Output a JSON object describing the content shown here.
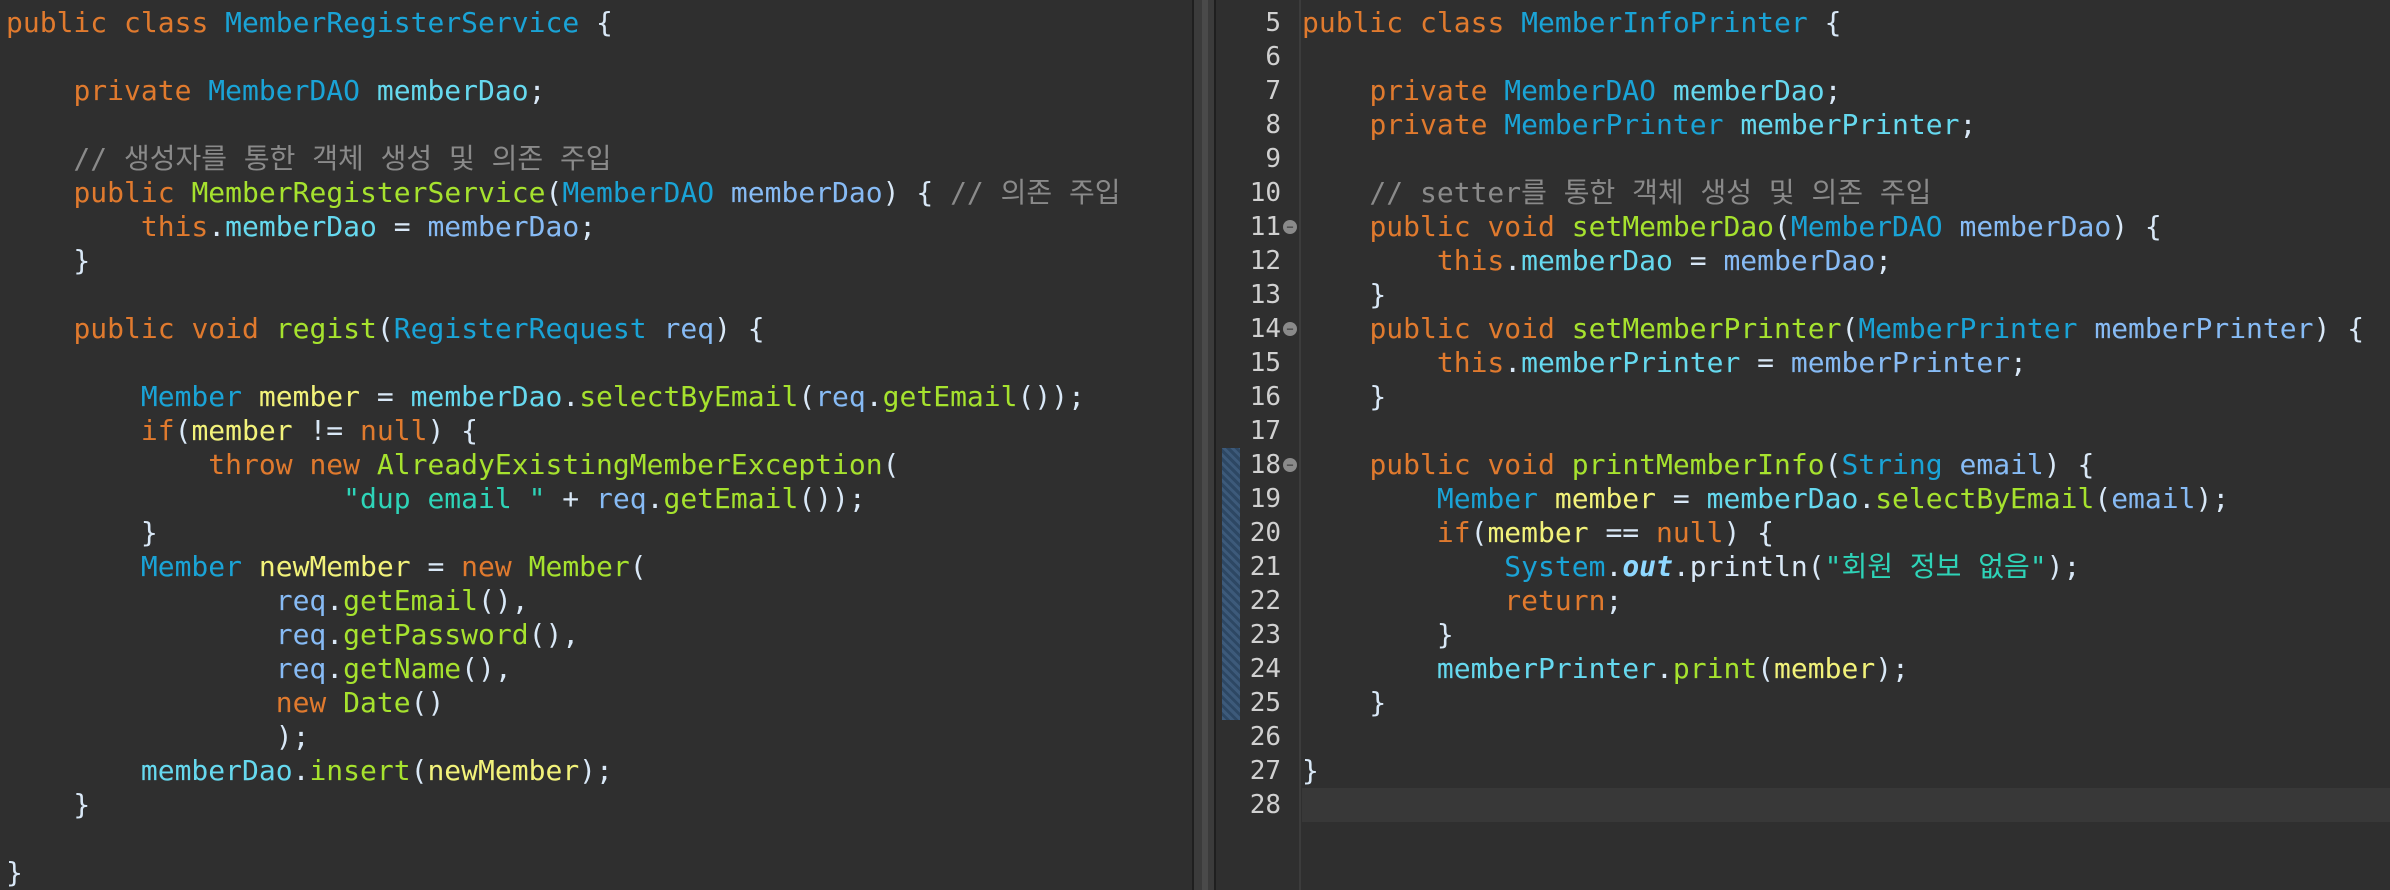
{
  "editor_left": {
    "file": "MemberRegisterService",
    "lines": [
      [
        [
          "kw",
          "public "
        ],
        [
          "kw",
          "class "
        ],
        [
          "ty",
          "MemberRegisterService"
        ],
        [
          "pn",
          " {"
        ]
      ],
      [],
      [
        [
          "pn",
          "    "
        ],
        [
          "kw",
          "private "
        ],
        [
          "ty",
          "MemberDAO "
        ],
        [
          "fld",
          "memberDao"
        ],
        [
          "pn",
          ";"
        ]
      ],
      [],
      [
        [
          "cm",
          "    // 생성자를 통한 객체 생성 및 의존 주입"
        ]
      ],
      [
        [
          "pn",
          "    "
        ],
        [
          "kw",
          "public "
        ],
        [
          "fn",
          "MemberRegisterService"
        ],
        [
          "pn",
          "("
        ],
        [
          "ty",
          "MemberDAO "
        ],
        [
          "pm",
          "memberDao"
        ],
        [
          "pn",
          ") { "
        ],
        [
          "cm",
          "// 의존 주입"
        ]
      ],
      [
        [
          "pn",
          "        "
        ],
        [
          "kw",
          "this"
        ],
        [
          "pn",
          "."
        ],
        [
          "fld",
          "memberDao"
        ],
        [
          "pn",
          " = "
        ],
        [
          "pm",
          "memberDao"
        ],
        [
          "pn",
          ";"
        ]
      ],
      [
        [
          "pn",
          "    }"
        ]
      ],
      [],
      [
        [
          "pn",
          "    "
        ],
        [
          "kw",
          "public "
        ],
        [
          "kw",
          "void "
        ],
        [
          "fn",
          "regist"
        ],
        [
          "pn",
          "("
        ],
        [
          "ty",
          "RegisterRequest "
        ],
        [
          "pm",
          "req"
        ],
        [
          "pn",
          ") {"
        ]
      ],
      [],
      [
        [
          "pn",
          "        "
        ],
        [
          "ty",
          "Member "
        ],
        [
          "lv",
          "member"
        ],
        [
          "pn",
          " = "
        ],
        [
          "fld",
          "memberDao"
        ],
        [
          "pn",
          "."
        ],
        [
          "fn",
          "selectByEmail"
        ],
        [
          "pn",
          "("
        ],
        [
          "pm",
          "req"
        ],
        [
          "pn",
          "."
        ],
        [
          "fn",
          "getEmail"
        ],
        [
          "pn",
          "());"
        ]
      ],
      [
        [
          "pn",
          "        "
        ],
        [
          "kw",
          "if"
        ],
        [
          "pn",
          "("
        ],
        [
          "lv",
          "member"
        ],
        [
          "pn",
          " != "
        ],
        [
          "nl",
          "null"
        ],
        [
          "pn",
          ") {"
        ]
      ],
      [
        [
          "pn",
          "            "
        ],
        [
          "kw",
          "throw "
        ],
        [
          "kw",
          "new "
        ],
        [
          "fn",
          "AlreadyExistingMemberException"
        ],
        [
          "pn",
          "("
        ]
      ],
      [
        [
          "pn",
          "                    "
        ],
        [
          "st",
          "\"dup email \""
        ],
        [
          "pn",
          " + "
        ],
        [
          "pm",
          "req"
        ],
        [
          "pn",
          "."
        ],
        [
          "fn",
          "getEmail"
        ],
        [
          "pn",
          "());"
        ]
      ],
      [
        [
          "pn",
          "        }"
        ]
      ],
      [
        [
          "pn",
          "        "
        ],
        [
          "ty",
          "Member "
        ],
        [
          "lv",
          "newMember"
        ],
        [
          "pn",
          " = "
        ],
        [
          "kw",
          "new "
        ],
        [
          "fn",
          "Member"
        ],
        [
          "pn",
          "("
        ]
      ],
      [
        [
          "pn",
          "                "
        ],
        [
          "pm",
          "req"
        ],
        [
          "pn",
          "."
        ],
        [
          "fn",
          "getEmail"
        ],
        [
          "pn",
          "(),"
        ]
      ],
      [
        [
          "pn",
          "                "
        ],
        [
          "pm",
          "req"
        ],
        [
          "pn",
          "."
        ],
        [
          "fn",
          "getPassword"
        ],
        [
          "pn",
          "(),"
        ]
      ],
      [
        [
          "pn",
          "                "
        ],
        [
          "pm",
          "req"
        ],
        [
          "pn",
          "."
        ],
        [
          "fn",
          "getName"
        ],
        [
          "pn",
          "(),"
        ]
      ],
      [
        [
          "pn",
          "                "
        ],
        [
          "kw",
          "new "
        ],
        [
          "fn",
          "Date"
        ],
        [
          "pn",
          "()"
        ]
      ],
      [
        [
          "pn",
          "                );"
        ]
      ],
      [
        [
          "pn",
          "        "
        ],
        [
          "fld",
          "memberDao"
        ],
        [
          "pn",
          "."
        ],
        [
          "fn",
          "insert"
        ],
        [
          "pn",
          "("
        ],
        [
          "lv",
          "newMember"
        ],
        [
          "pn",
          ");"
        ]
      ],
      [
        [
          "pn",
          "    }"
        ]
      ],
      [],
      [
        [
          "pn",
          "}"
        ]
      ]
    ]
  },
  "editor_right": {
    "file": "MemberInfoPrinter",
    "line_numbers": [
      "5",
      "6",
      "7",
      "8",
      "9",
      "10",
      "11",
      "12",
      "13",
      "14",
      "15",
      "16",
      "17",
      "18",
      "19",
      "20",
      "21",
      "22",
      "23",
      "24",
      "25",
      "26",
      "27",
      "28"
    ],
    "fold_markers": [
      "11",
      "14",
      "18"
    ],
    "lines": [
      [
        [
          "kw",
          "public "
        ],
        [
          "kw",
          "class "
        ],
        [
          "ty",
          "MemberInfoPrinter"
        ],
        [
          "pn",
          " {"
        ]
      ],
      [],
      [
        [
          "pn",
          "    "
        ],
        [
          "kw",
          "private "
        ],
        [
          "ty",
          "MemberDAO "
        ],
        [
          "fld",
          "memberDao"
        ],
        [
          "pn",
          ";"
        ]
      ],
      [
        [
          "pn",
          "    "
        ],
        [
          "kw",
          "private "
        ],
        [
          "ty",
          "MemberPrinter "
        ],
        [
          "fld",
          "memberPrinter"
        ],
        [
          "pn",
          ";"
        ]
      ],
      [],
      [
        [
          "cm",
          "    // setter를 통한 객체 생성 및 의존 주입"
        ]
      ],
      [
        [
          "pn",
          "    "
        ],
        [
          "kw",
          "public "
        ],
        [
          "kw",
          "void "
        ],
        [
          "fn",
          "setMemberDao"
        ],
        [
          "pn",
          "("
        ],
        [
          "ty",
          "MemberDAO "
        ],
        [
          "pm",
          "memberDao"
        ],
        [
          "pn",
          ") {"
        ]
      ],
      [
        [
          "pn",
          "        "
        ],
        [
          "kw",
          "this"
        ],
        [
          "pn",
          "."
        ],
        [
          "fld",
          "memberDao"
        ],
        [
          "pn",
          " = "
        ],
        [
          "pm",
          "memberDao"
        ],
        [
          "pn",
          ";"
        ]
      ],
      [
        [
          "pn",
          "    }"
        ]
      ],
      [
        [
          "pn",
          "    "
        ],
        [
          "kw",
          "public "
        ],
        [
          "kw",
          "void "
        ],
        [
          "fn",
          "setMemberPrinter"
        ],
        [
          "pn",
          "("
        ],
        [
          "ty",
          "MemberPrinter "
        ],
        [
          "pm",
          "memberPrinter"
        ],
        [
          "pn",
          ") {"
        ]
      ],
      [
        [
          "pn",
          "        "
        ],
        [
          "kw",
          "this"
        ],
        [
          "pn",
          "."
        ],
        [
          "fld",
          "memberPrinter"
        ],
        [
          "pn",
          " = "
        ],
        [
          "pm",
          "memberPrinter"
        ],
        [
          "pn",
          ";"
        ]
      ],
      [
        [
          "pn",
          "    }"
        ]
      ],
      [],
      [
        [
          "pn",
          "    "
        ],
        [
          "kw",
          "public "
        ],
        [
          "kw",
          "void "
        ],
        [
          "fn",
          "printMemberInfo"
        ],
        [
          "pn",
          "("
        ],
        [
          "ty",
          "String "
        ],
        [
          "pm",
          "email"
        ],
        [
          "pn",
          ") {"
        ]
      ],
      [
        [
          "pn",
          "        "
        ],
        [
          "ty",
          "Member "
        ],
        [
          "lv",
          "member"
        ],
        [
          "pn",
          " = "
        ],
        [
          "fld",
          "memberDao"
        ],
        [
          "pn",
          "."
        ],
        [
          "fn",
          "selectByEmail"
        ],
        [
          "pn",
          "("
        ],
        [
          "pm",
          "email"
        ],
        [
          "pn",
          ");"
        ]
      ],
      [
        [
          "pn",
          "        "
        ],
        [
          "kw",
          "if"
        ],
        [
          "pn",
          "("
        ],
        [
          "lv",
          "member"
        ],
        [
          "pn",
          " == "
        ],
        [
          "nl",
          "null"
        ],
        [
          "pn",
          ") {"
        ]
      ],
      [
        [
          "pn",
          "            "
        ],
        [
          "ty",
          "System"
        ],
        [
          "pn",
          "."
        ],
        [
          "sv",
          "out"
        ],
        [
          "pn",
          "."
        ],
        [
          "pn",
          "println"
        ],
        [
          "pn",
          "("
        ],
        [
          "st",
          "\"회원 정보 없음\""
        ],
        [
          "pn",
          ");"
        ]
      ],
      [
        [
          "pn",
          "            "
        ],
        [
          "kw",
          "return"
        ],
        [
          "pn",
          ";"
        ]
      ],
      [
        [
          "pn",
          "        }"
        ]
      ],
      [
        [
          "pn",
          "        "
        ],
        [
          "fld",
          "memberPrinter"
        ],
        [
          "pn",
          "."
        ],
        [
          "fn",
          "print"
        ],
        [
          "pn",
          "("
        ],
        [
          "lv",
          "member"
        ],
        [
          "pn",
          ");"
        ]
      ],
      [
        [
          "pn",
          "    }"
        ]
      ],
      [],
      [
        [
          "pn",
          "}"
        ]
      ],
      []
    ]
  }
}
